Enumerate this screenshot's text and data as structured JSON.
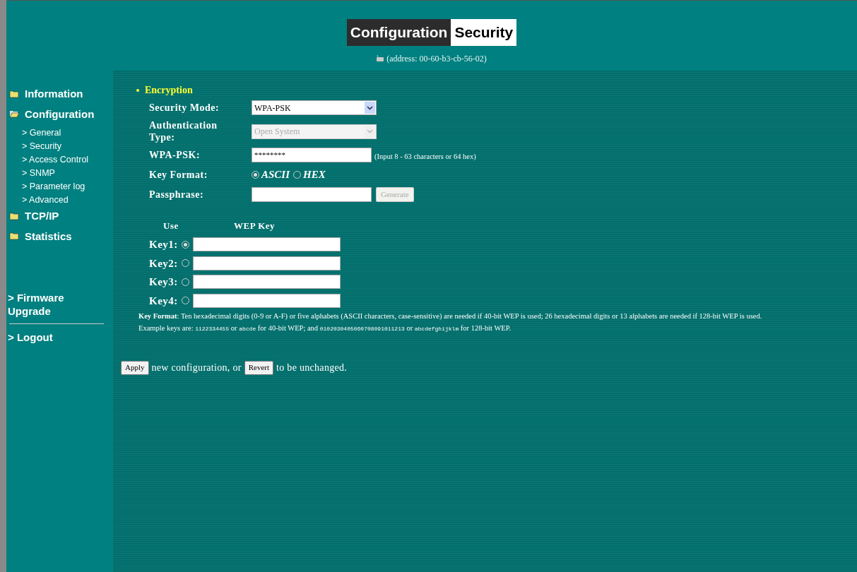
{
  "header": {
    "title_parts": [
      {
        "text": "Configuration",
        "kind": "dark"
      },
      {
        "text": "Security",
        "kind": "light"
      }
    ],
    "address": "(address: 00-60-b3-cb-56-02)"
  },
  "sidebar": {
    "items": [
      {
        "label": "Information",
        "expanded": false
      },
      {
        "label": "Configuration",
        "expanded": true,
        "children": [
          {
            "label": "> General"
          },
          {
            "label": "> Security"
          },
          {
            "label": "> Access Control"
          },
          {
            "label": "> SNMP"
          },
          {
            "label": "> Parameter log"
          },
          {
            "label": "> Advanced"
          }
        ]
      },
      {
        "label": "TCP/IP",
        "expanded": false
      },
      {
        "label": "Statistics",
        "expanded": false
      }
    ],
    "firmware": "> Firmware Upgrade",
    "logout": "> Logout"
  },
  "section_title": "Encryption",
  "form": {
    "security_mode": {
      "label": "Security Mode:",
      "value": "WPA-PSK",
      "disabled": false
    },
    "auth_type": {
      "label": "Authentication Type:",
      "value": "Open System",
      "disabled": true
    },
    "wpa_psk": {
      "label": "WPA-PSK:",
      "value": "********",
      "hint": "(Input 8 - 63 characters or 64 hex)"
    },
    "key_format": {
      "label": "Key Format:",
      "options": [
        {
          "label": "ASCII",
          "selected": true
        },
        {
          "label": "HEX",
          "selected": false
        }
      ]
    },
    "passphrase": {
      "label": "Passphrase:",
      "button": "Generate",
      "button_disabled": true
    }
  },
  "wep": {
    "columns": [
      "Use",
      "WEP Key"
    ],
    "keys": [
      {
        "label": "Key1:",
        "selected": true
      },
      {
        "label": "Key2:",
        "selected": false
      },
      {
        "label": "Key3:",
        "selected": false
      },
      {
        "label": "Key4:",
        "selected": false
      }
    ],
    "note": "**Key Format**: Ten hexadecimal digits (0-9 or A-F) or five alphabets (ASCII characters, case-sensitive) are needed if 40-bit WEP is used; 26 hexadecimal digits or 13 alphabets are needed if 128-bit WEP is used.",
    "example": [
      {
        "text": "Example keys are: ",
        "kind": "plain"
      },
      {
        "text": "1122334455",
        "kind": "mono"
      },
      {
        "text": " or ",
        "kind": "plain"
      },
      {
        "text": "abcde",
        "kind": "mono"
      },
      {
        "text": " for 40-bit WEP; and ",
        "kind": "plain"
      },
      {
        "text": "0102030405060708091011213",
        "kind": "mono"
      },
      {
        "text": " or ",
        "kind": "plain"
      },
      {
        "text": "abcdefghijklm",
        "kind": "mono"
      },
      {
        "text": " for 128-bit WEP.",
        "kind": "plain"
      }
    ]
  },
  "actions": {
    "apply": "Apply",
    "middle": "new configuration, or",
    "revert": "Revert",
    "end": "to be unchanged."
  }
}
